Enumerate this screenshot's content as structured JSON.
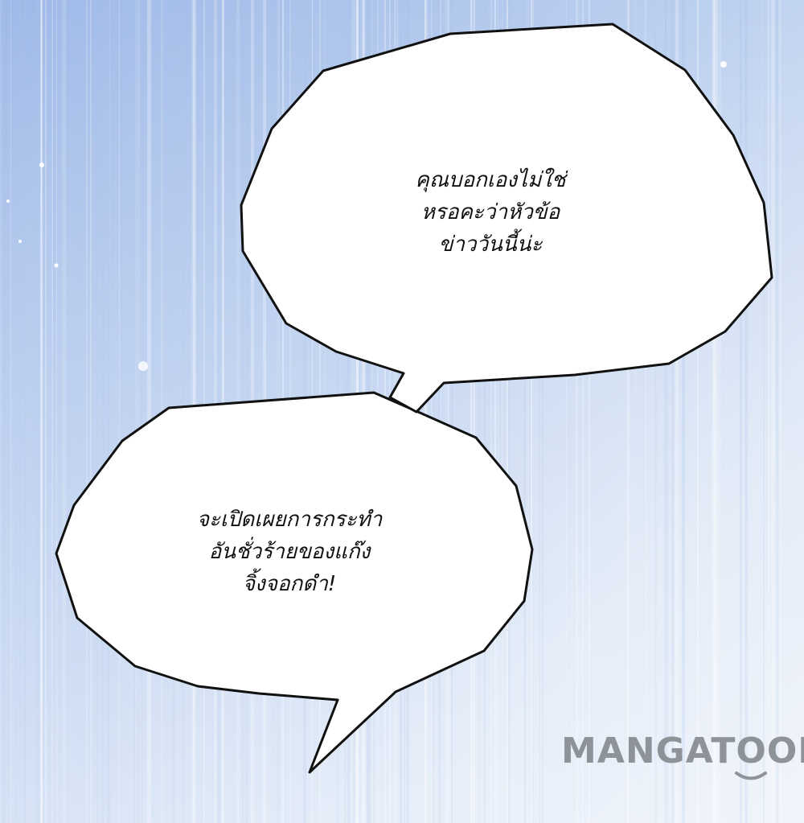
{
  "background": {
    "base_color": "#dde8f6",
    "stripe_color": "#a9c2ea"
  },
  "bubbles": {
    "top": {
      "lines": [
        "คุณบอกเองไม่ใช่",
        "หรอคะว่าหัวข้อ",
        "ข่าววันนี้น่ะ"
      ]
    },
    "bottom": {
      "lines": [
        "จะเปิดเผยการกระทำ",
        "อันชั่วร้ายของแก๊ง",
        "จิ้งจอกดำ!"
      ]
    }
  },
  "watermark": {
    "text": "MANGATOON",
    "color": "#8d9398"
  }
}
